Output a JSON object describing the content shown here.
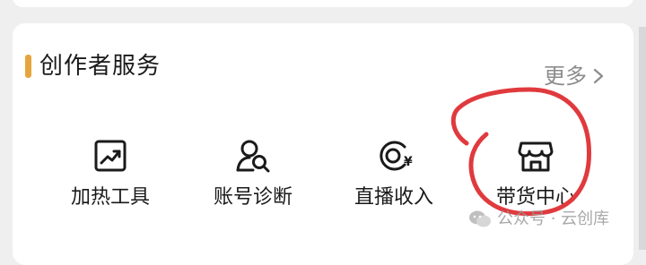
{
  "section": {
    "title": "创作者服务",
    "more_label": "更多",
    "accent_color": "#e6a53c"
  },
  "tools": [
    {
      "label": "加热工具",
      "icon": "trend-chart-icon"
    },
    {
      "label": "账号诊断",
      "icon": "user-search-icon"
    },
    {
      "label": "直播收入",
      "icon": "live-income-icon"
    },
    {
      "label": "带货中心",
      "icon": "storefront-icon"
    }
  ],
  "annotation": {
    "circle_color": "#e03a3e",
    "circled_item": "带货中心"
  },
  "watermark": {
    "text": "公众号 · 云创库",
    "icon": "wechat-icon"
  }
}
